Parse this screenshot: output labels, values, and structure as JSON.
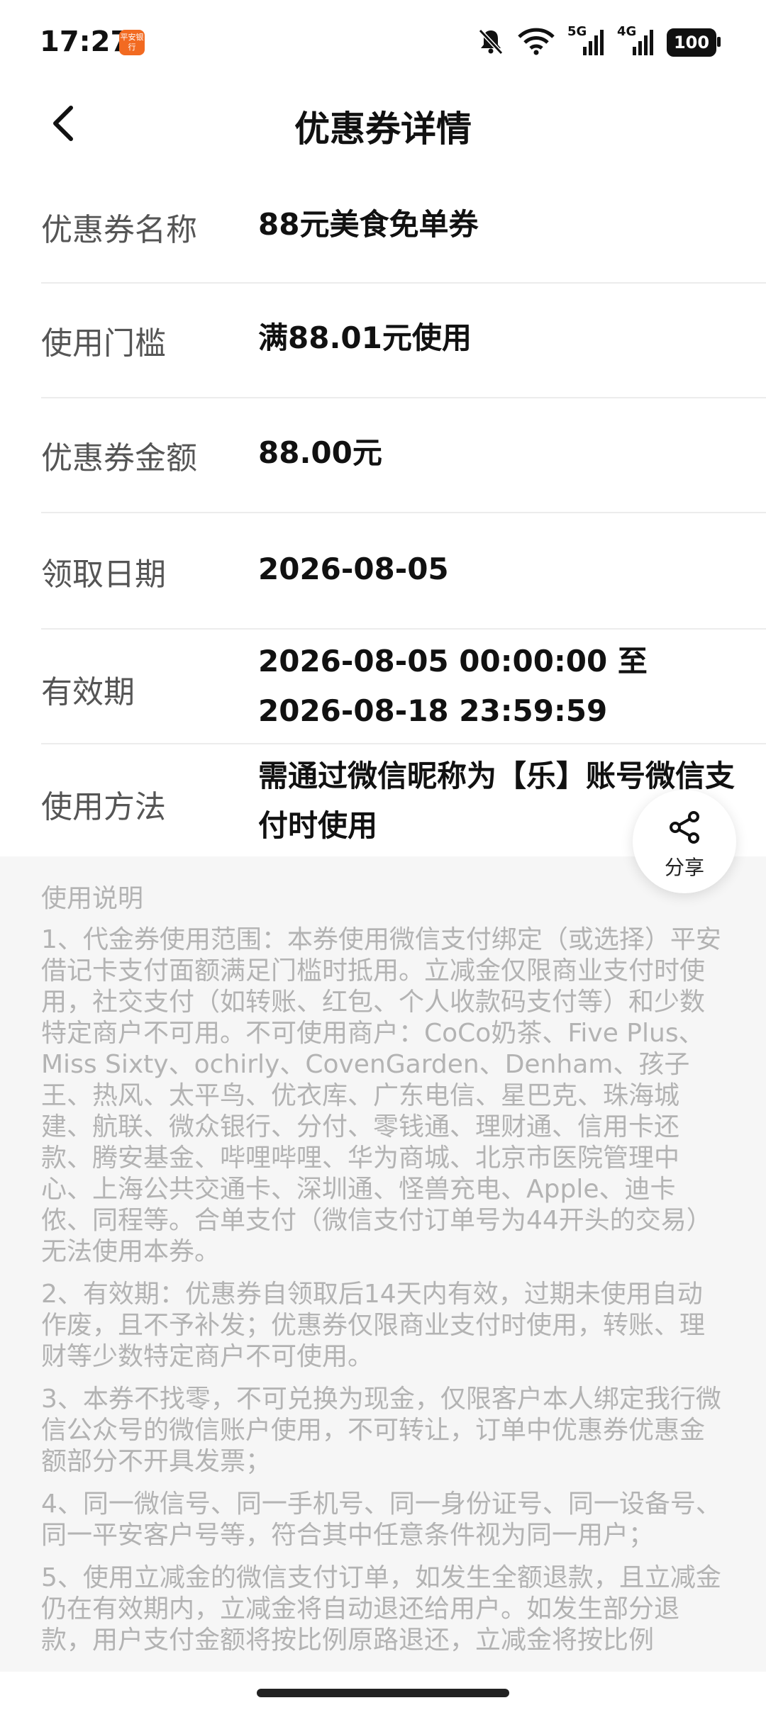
{
  "status_bar": {
    "time": "17:27",
    "app_icon_text": "平安银行",
    "net1": "5G",
    "net2": "4G",
    "battery": "100"
  },
  "nav": {
    "title": "优惠券详情"
  },
  "details": [
    {
      "label": "优惠券名称",
      "value": "88元美食免单券"
    },
    {
      "label": "使用门槛",
      "value": "满88.01元使用"
    },
    {
      "label": "优惠券金额",
      "value": "88.00元"
    },
    {
      "label": "领取日期",
      "value": "2026-08-05"
    },
    {
      "label": "有效期",
      "value": "2026-08-05 00:00:00 至 2026-08-18 23:59:59"
    },
    {
      "label": "使用方法",
      "value": "需通过微信昵称为【乐】账号微信支付时使用"
    }
  ],
  "notes": {
    "title": "使用说明",
    "paragraphs": [
      "1、代金券使用范围：本券使用微信支付绑定（或选择）平安借记卡支付面额满足门槛时抵用。立减金仅限商业支付时使用，社交支付（如转账、红包、个人收款码支付等）和少数特定商户不可用。不可使用商户：CoCo奶茶、Five Plus、Miss Sixty、ochirly、CovenGarden、Denham、孩子王、热风、太平鸟、优衣库、广东电信、星巴克、珠海城建、航联、微众银行、分付、零钱通、理财通、信用卡还款、腾安基金、哔哩哔哩、华为商城、北京市医院管理中心、上海公共交通卡、深圳通、怪兽充电、Apple、迪卡侬、同程等。合单支付（微信支付订单号为44开头的交易）无法使用本券。",
      "2、有效期：优惠券自领取后14天内有效，过期未使用自动作废，且不予补发；优惠券仅限商业支付时使用，转账、理财等少数特定商户不可使用。",
      "3、本券不找零，不可兑换为现金，仅限客户本人绑定我行微信公众号的微信账户使用，不可转让，订单中优惠券优惠金额部分不开具发票；",
      "4、同一微信号、同一手机号、同一身份证号、同一设备号、同一平安客户号等，符合其中任意条件视为同一用户；",
      "5、使用立减金的微信支付订单，如发生全额退款，且立减金仍在有效期内，立减金将自动退还给用户。如发生部分退款，用户支付金额将按比例原路退还，立减金将按比例"
    ]
  },
  "share": {
    "label": "分享"
  }
}
